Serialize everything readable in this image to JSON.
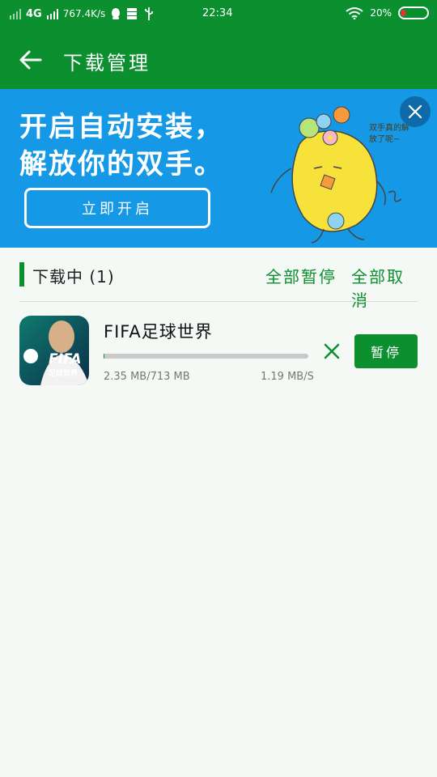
{
  "status_bar": {
    "network": "4G",
    "speed": "767.4K/s",
    "time": "22:34",
    "battery": "20%",
    "icons": [
      "signal-icon",
      "qq-icon",
      "storage-icon",
      "usb-icon",
      "wifi-icon",
      "battery-icon"
    ]
  },
  "app_bar": {
    "title": "下载管理",
    "back_icon": "arrow-left-icon"
  },
  "banner": {
    "line1": "开启自动安装，",
    "line2": "解放你的双手。",
    "button_label": "立即开启",
    "mascot_note": "双手真的解放了呢~",
    "close_icon": "close-icon"
  },
  "downloading_section": {
    "title": "下载中 (1)",
    "pause_all_label": "全部暂停",
    "cancel_all_label": "全部取消"
  },
  "downloads": [
    {
      "name": "FIFA足球世界",
      "size_text": "2.35 MB/713 MB",
      "speed_text": "1.19 MB/S",
      "progress": 0.0033,
      "pause_label": "暂停",
      "icon_text": "FIFA",
      "icon_subtext": "足球世界"
    }
  ],
  "colors": {
    "brand_green": "#0c8f2e",
    "banner_blue": "#1598e6",
    "background": "#f5f9f5"
  }
}
